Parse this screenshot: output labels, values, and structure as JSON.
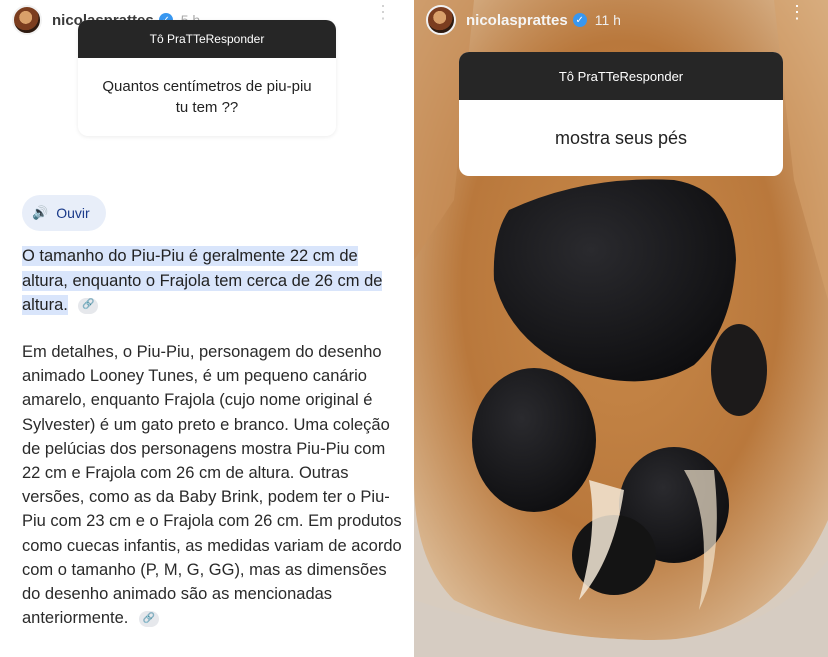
{
  "left": {
    "username": "nicolasprattes",
    "time": "5 h",
    "question_header": "Tô PraTTeResponder",
    "question_text": "Quantos centímetros de piu-piu tu tem ??",
    "listen_label": "Ouvir",
    "answer_highlight": "O tamanho do Piu-Piu é geralmente 22 cm de altura, enquanto o Frajola tem cerca de 26 cm de altura",
    "answer_period": ".",
    "details": "Em detalhes, o Piu-Piu, personagem do desenho animado Looney Tunes, é um pequeno canário amarelo, enquanto Frajola (cujo nome original é Sylvester) é um gato preto e branco. Uma coleção de pelúcias dos personagens mostra Piu-Piu com 22 cm e Frajola com 26 cm de altura. Outras versões, como as da Baby Brink, podem ter o Piu-Piu com 23 cm e o Frajola com 26 cm. Em produtos como cuecas infantis, as medidas variam de acordo com o tamanho (P, M, G, GG), mas as dimensões do desenho animado são as mencionadas anteriormente."
  },
  "right": {
    "username": "nicolasprattes",
    "time": "11 h",
    "question_header": "Tô PraTTeResponder",
    "question_text": "mostra seus pés"
  },
  "icons": {
    "verified": "verified-badge-icon",
    "more": "more-vertical-icon",
    "speaker": "speaker-icon",
    "link": "link-icon"
  },
  "colors": {
    "card_header": "#262626",
    "highlight": "#d9e5fb",
    "listen_chip": "#e8eef9",
    "verified": "#3897f0"
  }
}
